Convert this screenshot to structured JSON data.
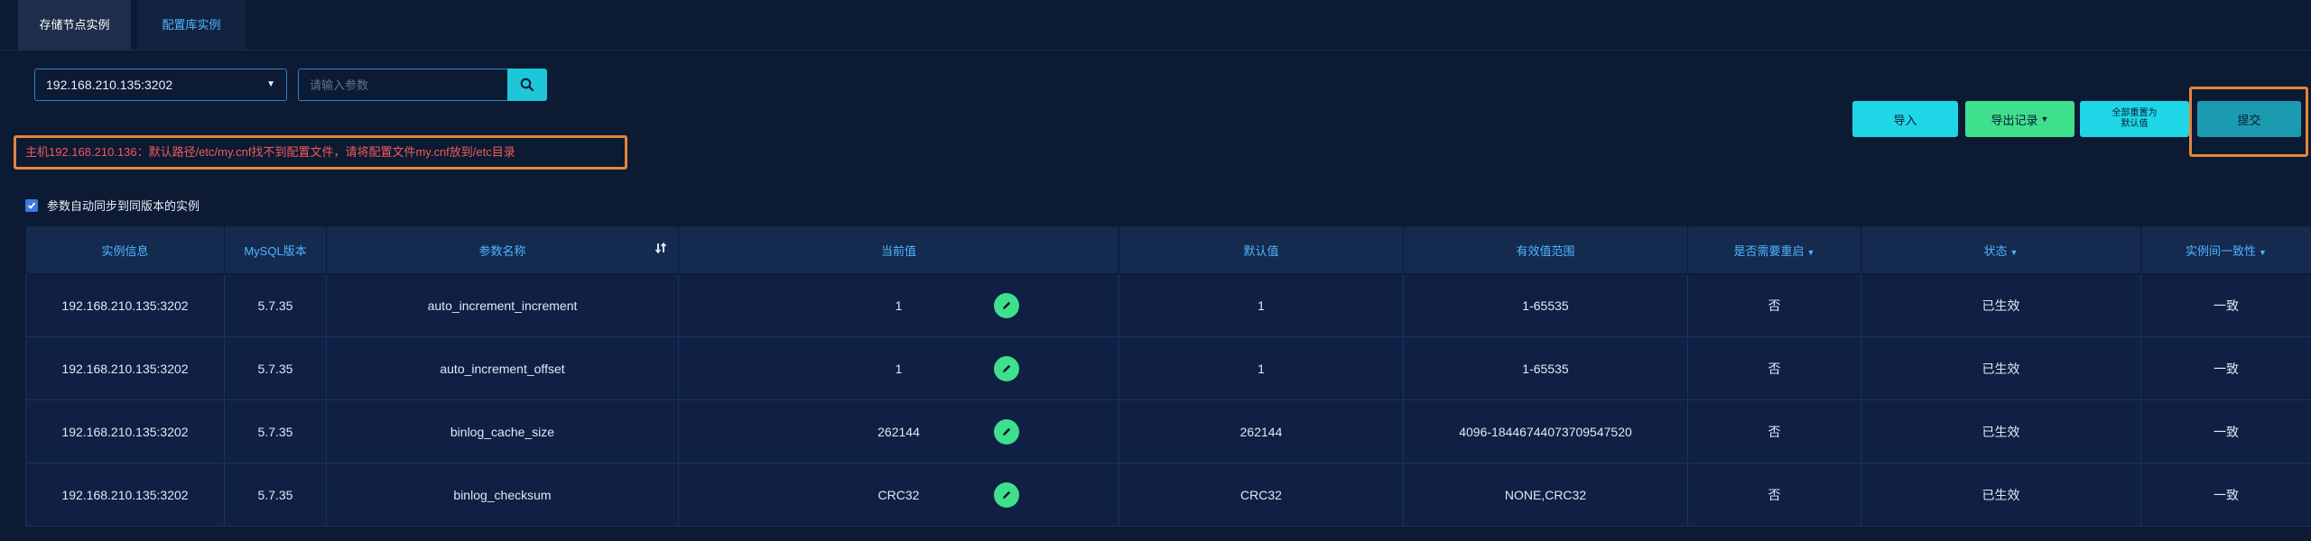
{
  "tabs": [
    {
      "label": "存储节点实例"
    },
    {
      "label": "配置库实例"
    }
  ],
  "instance_select": {
    "value": "192.168.210.135:3202"
  },
  "search": {
    "placeholder": "请输入参数"
  },
  "warning": {
    "text": "主机192.168.210.136：默认路径/etc/my.cnf找不到配置文件，请将配置文件my.cnf放到/etc目录"
  },
  "toolbar": {
    "import_label": "导入",
    "export_label": "导出记录",
    "reset_line1": "全部重置为",
    "reset_line2": "默认值",
    "submit_label": "提交"
  },
  "sync_checkbox": {
    "label": "参数自动同步到同版本的实例",
    "checked": true
  },
  "table": {
    "headers": {
      "instance": "实例信息",
      "mysql_version": "MySQL版本",
      "param_name": "参数名称",
      "current": "当前值",
      "default": "默认值",
      "range": "有效值范围",
      "restart": "是否需要重启",
      "status": "状态",
      "consistency": "实例间一致性"
    },
    "rows": [
      {
        "instance": "192.168.210.135:3202",
        "version": "5.7.35",
        "name": "auto_increment_increment",
        "current": "1",
        "default": "1",
        "range": "1-65535",
        "restart": "否",
        "status": "已生效",
        "consistency": "一致"
      },
      {
        "instance": "192.168.210.135:3202",
        "version": "5.7.35",
        "name": "auto_increment_offset",
        "current": "1",
        "default": "1",
        "range": "1-65535",
        "restart": "否",
        "status": "已生效",
        "consistency": "一致"
      },
      {
        "instance": "192.168.210.135:3202",
        "version": "5.7.35",
        "name": "binlog_cache_size",
        "current": "262144",
        "default": "262144",
        "range": "4096-18446744073709547520",
        "restart": "否",
        "status": "已生效",
        "consistency": "一致"
      },
      {
        "instance": "192.168.210.135:3202",
        "version": "5.7.35",
        "name": "binlog_checksum",
        "current": "CRC32",
        "default": "CRC32",
        "range": "NONE,CRC32",
        "restart": "否",
        "status": "已生效",
        "consistency": "一致"
      }
    ]
  },
  "colors": {
    "background": "#0d1a33",
    "accent_cyan": "#1fd6e6",
    "accent_green": "#3ee08c",
    "warning_text": "#f05a5a",
    "highlight_border": "#e0873c",
    "header_text": "#4fb6ff"
  },
  "icons": {
    "search": "search-icon",
    "edit": "pencil-icon",
    "sort": "sort-icon",
    "dropdown": "chevron-down-icon",
    "check": "check-icon"
  }
}
